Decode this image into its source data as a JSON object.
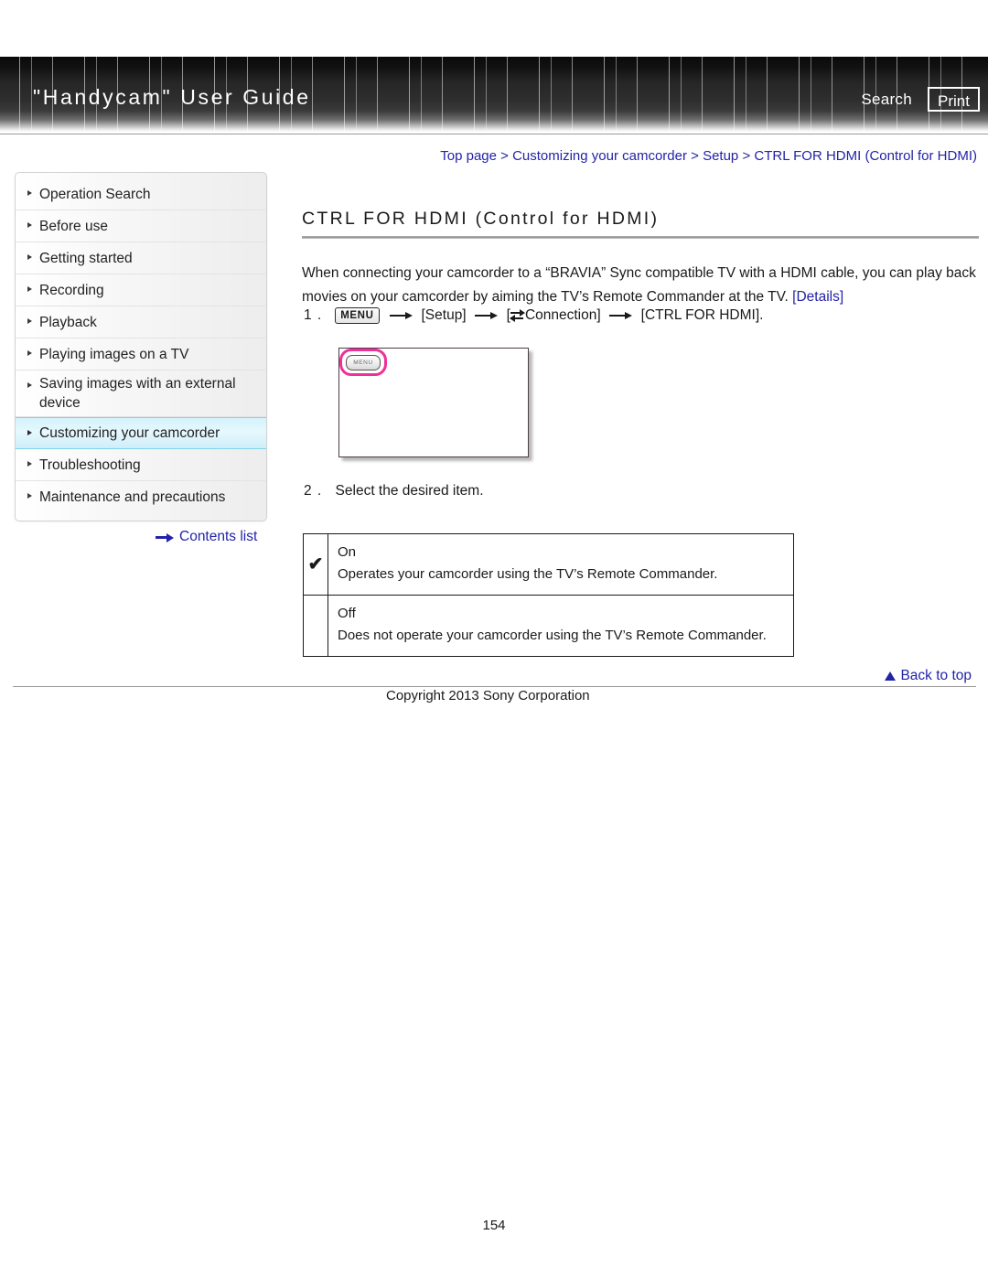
{
  "header": {
    "brand_title": "\"Handycam\" User Guide",
    "search_label": "Search",
    "print_label": "Print"
  },
  "sidebar": {
    "items": [
      {
        "label": "Operation Search",
        "active": false
      },
      {
        "label": "Before use",
        "active": false
      },
      {
        "label": "Getting started",
        "active": false
      },
      {
        "label": "Recording",
        "active": false
      },
      {
        "label": "Playback",
        "active": false
      },
      {
        "label": "Playing images on a TV",
        "active": false
      },
      {
        "label": "Saving images with an external device",
        "active": false
      },
      {
        "label": "Customizing your camcorder",
        "active": true
      },
      {
        "label": "Troubleshooting",
        "active": false
      },
      {
        "label": "Maintenance and precautions",
        "active": false
      }
    ],
    "contents_list_label": "Contents list"
  },
  "main": {
    "breadcrumb": "Top page > Customizing your camcorder > Setup > CTRL FOR HDMI (Control for HDMI)",
    "page_title": "CTRL FOR HDMI (Control for HDMI)",
    "intro_text": "When connecting your camcorder to a “BRAVIA” Sync compatible TV with a HDMI cable, you can play back movies on your camcorder by aiming the TV’s Remote Commander at the TV. ",
    "details_link": "[Details]",
    "step1": {
      "number": "1 .",
      "menu_chip": "MENU",
      "setup_label": "[Setup]",
      "connection_label": "Connection]",
      "connection_bracket_open": "[",
      "final_label": "[CTRL FOR HDMI]."
    },
    "screenshot": {
      "menu_button_label": "MENU"
    },
    "step2": {
      "number": "2 .",
      "text": "Select the desired item."
    },
    "options": [
      {
        "selected_mark": "✔",
        "name": "On",
        "description": "Operates your camcorder using the TV’s Remote Commander."
      },
      {
        "selected_mark": "",
        "name": "Off",
        "description": "Does not operate your camcorder using the TV’s Remote Commander."
      }
    ]
  },
  "footer": {
    "back_to_top": "Back to top",
    "copyright": "Copyright 2013 Sony Corporation",
    "page_number": "154"
  },
  "colors": {
    "link": "#2323a8",
    "highlight_pink": "#ef3098",
    "active_nav": "#d4f2fb"
  }
}
